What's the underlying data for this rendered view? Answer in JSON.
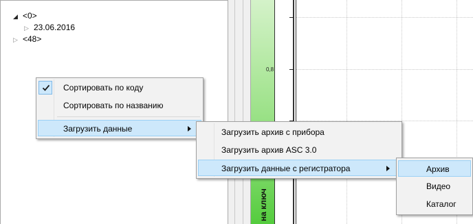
{
  "tree": {
    "nodes": [
      {
        "label": "<0>",
        "state": "expanded",
        "expander_icon": "triangle-expanded-icon"
      },
      {
        "label": "23.06.2016",
        "state": "collapsed",
        "expander_icon": "triangle-collapsed-icon"
      },
      {
        "label": "<48>",
        "state": "collapsed",
        "expander_icon": "triangle-collapsed-icon"
      }
    ]
  },
  "chart": {
    "y_tick_label": "0,8",
    "vertical_label": "на ключ"
  },
  "context_menu": {
    "items": [
      {
        "label": "Сортировать по коду",
        "checked": true,
        "icon": "checkmark-icon"
      },
      {
        "label": "Сортировать по названию",
        "checked": false
      },
      {
        "label": "Загрузить данные",
        "has_submenu": true,
        "highlighted": true
      }
    ]
  },
  "submenu_load": {
    "items": [
      {
        "label": "Загрузить архив с прибора"
      },
      {
        "label": "Загрузить архив ASC 3.0"
      },
      {
        "label": "Загрузить данные с регистратора",
        "has_submenu": true,
        "highlighted": true
      }
    ]
  },
  "submenu_registrator": {
    "items": [
      {
        "label": "Архив",
        "highlighted": true
      },
      {
        "label": "Видео"
      },
      {
        "label": "Каталог"
      }
    ]
  },
  "colors": {
    "highlight": "#cde8fb",
    "highlight_border": "#9ad0f5",
    "menu_bg": "#f2f2f2",
    "green_top": "#d4f2c9",
    "green_bottom": "#54cc3d"
  }
}
